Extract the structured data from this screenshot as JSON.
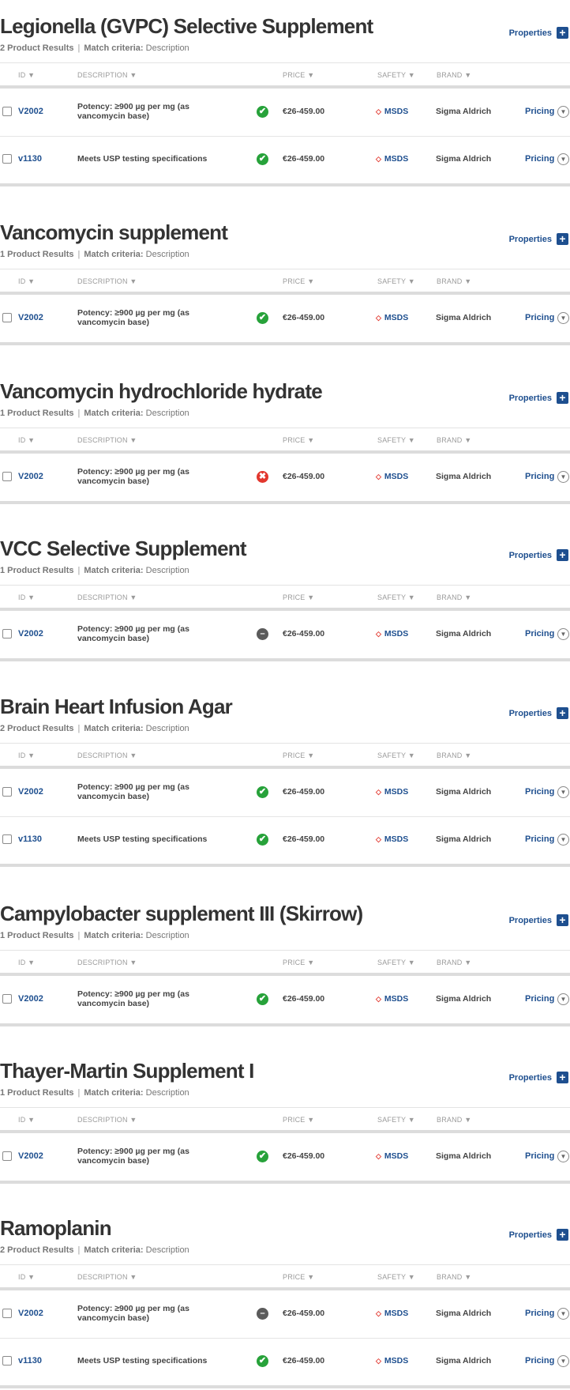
{
  "columns": [
    "ID ▼",
    "DESCRIPTION ▼",
    "PRICE ▼",
    "SAFETY ▼",
    "BRAND ▼"
  ],
  "labels": {
    "properties": "Properties",
    "match_criteria": "Match criteria:",
    "description": "Description",
    "msds": "MSDS",
    "pricing": "Pricing"
  },
  "colors": {
    "link_blue": "#1e4f8f",
    "ok_green": "#27a23a",
    "error_red": "#e2372e",
    "neutral_gray": "#5b5b5b"
  },
  "products": [
    {
      "title": "Legionella (GVPC) Selective Supplement",
      "results": "2 Product Results",
      "rows": [
        {
          "id": "V2002",
          "description": "Potency: ≥900 µg per mg (as vancomycin base)",
          "status": "ok",
          "price": "€26-459.00",
          "brand": "Sigma Aldrich"
        },
        {
          "id": "v1130",
          "description": "Meets USP testing specifications",
          "status": "ok",
          "price": "€26-459.00",
          "brand": "Sigma Aldrich"
        }
      ]
    },
    {
      "title": "Vancomycin supplement",
      "results": "1 Product Results",
      "rows": [
        {
          "id": "V2002",
          "description": "Potency: ≥900 µg per mg (as vancomycin base)",
          "status": "ok",
          "price": "€26-459.00",
          "brand": "Sigma Aldrich"
        }
      ]
    },
    {
      "title": "Vancomycin hydrochloride hydrate",
      "results": "1 Product Results",
      "rows": [
        {
          "id": "V2002",
          "description": "Potency: ≥900 µg per mg (as vancomycin base)",
          "status": "no",
          "price": "€26-459.00",
          "brand": "Sigma Aldrich"
        }
      ]
    },
    {
      "title": "VCC Selective Supplement",
      "results": "1 Product Results",
      "rows": [
        {
          "id": "V2002",
          "description": "Potency: ≥900 µg per mg (as vancomycin base)",
          "status": "na",
          "price": "€26-459.00",
          "brand": "Sigma Aldrich"
        }
      ]
    },
    {
      "title": "Brain Heart Infusion Agar",
      "results": "2 Product Results",
      "rows": [
        {
          "id": "V2002",
          "description": "Potency: ≥900 µg per mg (as vancomycin base)",
          "status": "ok",
          "price": "€26-459.00",
          "brand": "Sigma Aldrich"
        },
        {
          "id": "v1130",
          "description": "Meets USP testing specifications",
          "status": "ok",
          "price": "€26-459.00",
          "brand": "Sigma Aldrich"
        }
      ]
    },
    {
      "title": "Campylobacter supplement III (Skirrow)",
      "results": "1 Product Results",
      "rows": [
        {
          "id": "V2002",
          "description": "Potency: ≥900 µg per mg (as vancomycin base)",
          "status": "ok",
          "price": "€26-459.00",
          "brand": "Sigma Aldrich"
        }
      ]
    },
    {
      "title": "Thayer-Martin Supplement I",
      "results": "1 Product Results",
      "rows": [
        {
          "id": "V2002",
          "description": "Potency: ≥900 µg per mg (as vancomycin base)",
          "status": "ok",
          "price": "€26-459.00",
          "brand": "Sigma Aldrich"
        }
      ]
    },
    {
      "title": "Ramoplanin",
      "results": "2 Product Results",
      "rows": [
        {
          "id": "V2002",
          "description": "Potency: ≥900 µg per mg (as vancomycin base)",
          "status": "na",
          "price": "€26-459.00",
          "brand": "Sigma Aldrich"
        },
        {
          "id": "v1130",
          "description": "Meets USP testing specifications",
          "status": "ok",
          "price": "€26-459.00",
          "brand": "Sigma Aldrich"
        }
      ]
    }
  ]
}
